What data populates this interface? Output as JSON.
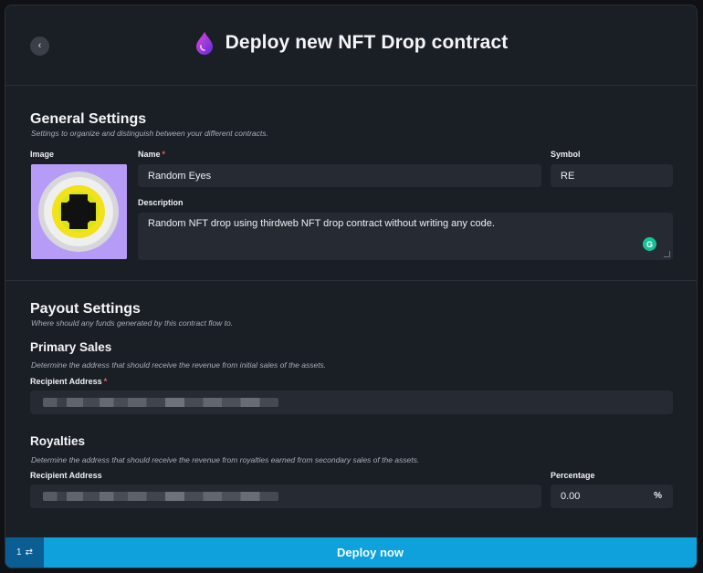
{
  "header": {
    "back_icon": "chevron-left-icon",
    "back_glyph": "‹",
    "title": "Deploy new NFT Drop contract",
    "logo_icon": "drop-logo-icon",
    "logo_color": "#7b3fe4"
  },
  "general": {
    "title": "General Settings",
    "hint": "Settings to organize and distinguish between your different contracts.",
    "image_label": "Image",
    "name_label": "Name",
    "name_value": "Random Eyes",
    "symbol_label": "Symbol",
    "symbol_value": "RE",
    "description_label": "Description",
    "description_value": "Random NFT drop using thirdweb NFT drop contract without writing any code.",
    "grammarly_icon": "grammarly-icon",
    "grammarly_glyph": "G"
  },
  "payout": {
    "title": "Payout Settings",
    "hint": "Where should any funds generated by this contract flow to.",
    "primary": {
      "title": "Primary Sales",
      "hint": "Determine the address that should receive the revenue from initial sales of the assets.",
      "recipient_label": "Recipient Address"
    },
    "royalties": {
      "title": "Royalties",
      "hint": "Determine the address that should receive the revenue from royalties earned from secondary sales of the assets.",
      "recipient_label": "Recipient Address",
      "percentage_label": "Percentage",
      "percentage_value": "0.00",
      "percentage_unit": "%"
    }
  },
  "footer": {
    "counter": "1",
    "counter_icon": "swap-arrows-icon",
    "counter_glyph": "⇄",
    "deploy_label": "Deploy now",
    "accent": "#0ea1dc"
  },
  "required_mark": "*"
}
